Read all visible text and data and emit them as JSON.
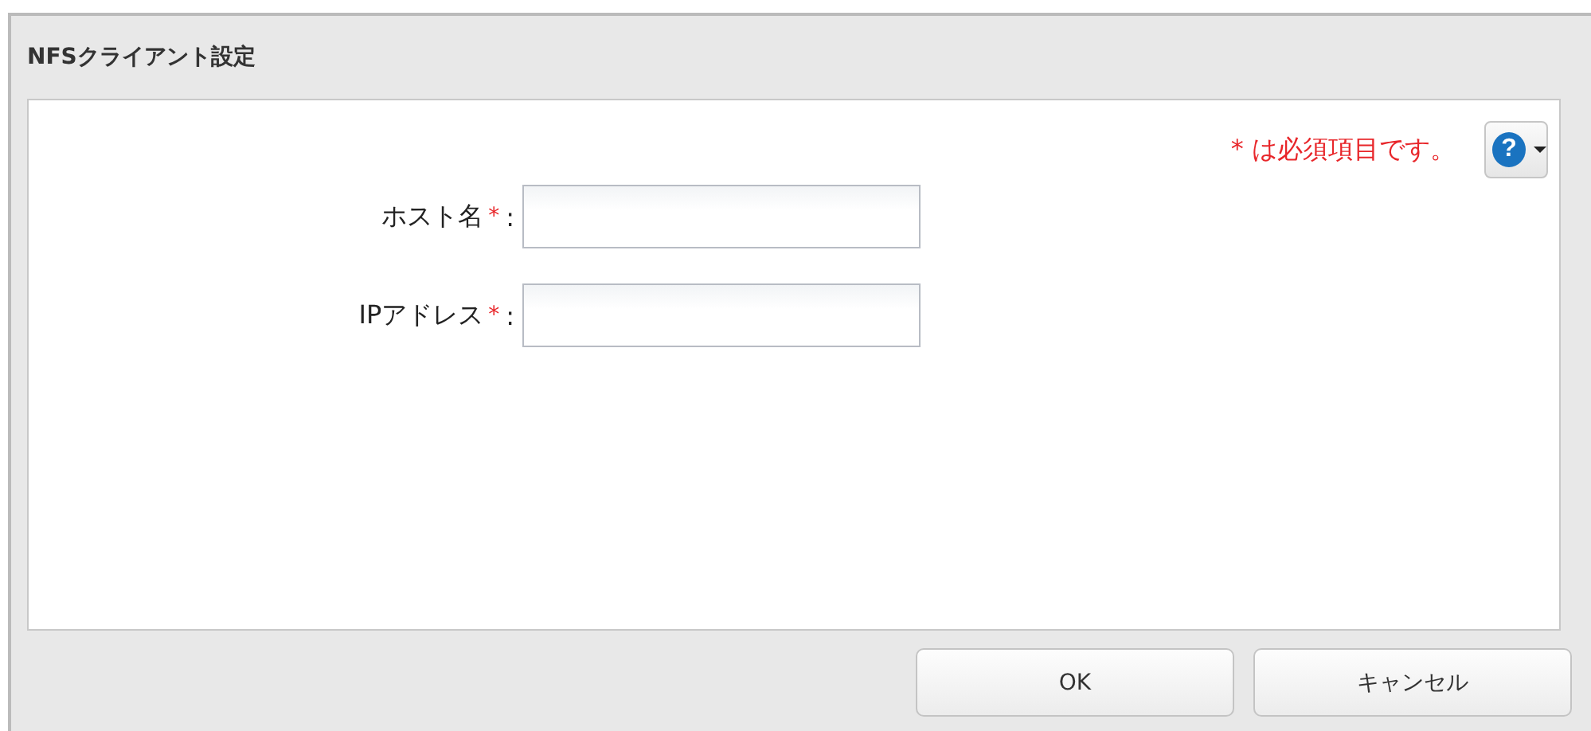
{
  "window": {
    "title": "NFSクライアント設定"
  },
  "required_note": {
    "mark": "*",
    "text": "は必須項目です。"
  },
  "help_button": {
    "glyph": "?"
  },
  "fields": [
    {
      "label": "ホスト名",
      "required_mark": "*",
      "separator": ":"
    },
    {
      "label": "IPアドレス",
      "required_mark": "*",
      "separator": ":"
    }
  ],
  "buttons": [
    "OK",
    "キャンセル"
  ]
}
